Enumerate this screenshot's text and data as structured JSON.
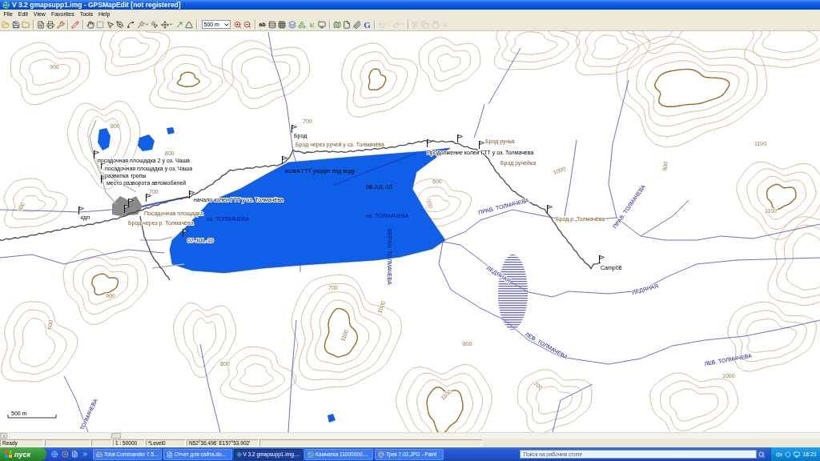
{
  "window": {
    "title": "V 3.2 gmapsupp1.img - GPSMapEdit [not registered]"
  },
  "menu": [
    "File",
    "Edit",
    "View",
    "Favorites",
    "Tools",
    "Help"
  ],
  "toolbar": [
    {
      "kind": "tool",
      "disabled": false
    },
    {
      "kind": "tool",
      "disabled": false
    },
    {
      "kind": "tool",
      "disabled": false
    },
    {
      "kind": "separator"
    },
    {
      "kind": "tool",
      "disabled": false
    },
    {
      "kind": "tool",
      "disabled": false
    },
    {
      "kind": "tool",
      "disabled": false
    },
    {
      "kind": "separator"
    },
    {
      "kind": "tool",
      "disabled": false
    },
    {
      "kind": "separator"
    },
    {
      "kind": "tool",
      "disabled": false
    },
    {
      "kind": "tool",
      "disabled": false
    },
    {
      "kind": "tool",
      "disabled": false
    },
    {
      "kind": "tool",
      "disabled": false
    },
    {
      "kind": "tool",
      "disabled": false
    },
    {
      "kind": "split",
      "disabled": false
    },
    {
      "kind": "tool",
      "disabled": false
    },
    {
      "kind": "split",
      "disabled": false
    },
    {
      "kind": "tool",
      "disabled": false
    },
    {
      "kind": "tool",
      "disabled": false
    },
    {
      "kind": "separator"
    },
    {
      "kind": "scale",
      "value": "500 m"
    },
    {
      "kind": "tool",
      "disabled": false
    },
    {
      "kind": "tool",
      "disabled": false
    },
    {
      "kind": "separator"
    },
    {
      "kind": "text",
      "label": "ab",
      "disabled": false
    },
    {
      "kind": "tool",
      "disabled": false
    },
    {
      "kind": "tool",
      "disabled": false
    },
    {
      "kind": "tool",
      "disabled": false
    },
    {
      "kind": "tool",
      "disabled": false
    },
    {
      "kind": "tool",
      "disabled": false
    },
    {
      "kind": "tool",
      "disabled": false
    },
    {
      "kind": "separator"
    },
    {
      "kind": "tool",
      "disabled": false
    },
    {
      "kind": "tool",
      "disabled": false
    },
    {
      "kind": "tool",
      "disabled": false
    },
    {
      "kind": "text",
      "label": "G",
      "disabled": false
    },
    {
      "kind": "separator"
    },
    {
      "kind": "split",
      "disabled": true
    },
    {
      "kind": "split",
      "disabled": true
    },
    {
      "kind": "separator"
    },
    {
      "kind": "tool",
      "disabled": true
    },
    {
      "kind": "tool",
      "disabled": true
    },
    {
      "kind": "tool",
      "disabled": true
    },
    {
      "kind": "tool",
      "disabled": true
    }
  ],
  "map": {
    "labels": [
      {
        "text": "посадочная площадка 2 у оз. Чаша",
        "kind": "waypoint"
      },
      {
        "text": "посадочная площадка у оз. Чаша",
        "kind": "waypoint"
      },
      {
        "text": "развилка тропы",
        "kind": "waypoint"
      },
      {
        "text": "место разворота автомобилей",
        "kind": "waypoint"
      },
      {
        "text": "кдп",
        "kind": "waypoint"
      },
      {
        "text": "Посадочная площадка",
        "kind": "note"
      },
      {
        "text": "начало колеи ГТТ у оз. Толмачёва",
        "kind": "waypoint"
      },
      {
        "text": "Брод через р. Толмачёва",
        "kind": "note"
      },
      {
        "text": "оз. ТОЛМАЧЕВА",
        "kind": "water"
      },
      {
        "text": "07-JUL-10",
        "kind": "waypoint"
      },
      {
        "text": "Брод",
        "kind": "waypoint"
      },
      {
        "text": "Брод через ручей у оз. Толмачёва",
        "kind": "note"
      },
      {
        "text": "колея ГТТ уходит под воду",
        "kind": "waypoint"
      },
      {
        "text": "08-JUL-10",
        "kind": "waypoint"
      },
      {
        "text": "оз. ТОЛМАЧЕВА",
        "kind": "water"
      },
      {
        "text": "ВЕРХН. ТОЛМАЧЕВА",
        "kind": "water"
      },
      {
        "text": "Брод ручья",
        "kind": "note"
      },
      {
        "text": "Продолжение колеи ГТТ у оз. Толмачева",
        "kind": "waypoint"
      },
      {
        "text": "Брод ручейка",
        "kind": "note"
      },
      {
        "text": "ПРАВ. ТОЛМАЧЕВА",
        "kind": "water"
      },
      {
        "text": "Брод р. Толмачёва",
        "kind": "note"
      },
      {
        "text": "ПРАВ. ТОЛМАЧЕВА",
        "kind": "water"
      },
      {
        "text": "Camp08",
        "kind": "waypoint"
      },
      {
        "text": "ЛЕДЯНАЯ",
        "kind": "water"
      },
      {
        "text": "ЛЕДЯНАЯ",
        "kind": "water"
      },
      {
        "text": "ЛЕВ. ТОЛМАЧЕВА",
        "kind": "water"
      },
      {
        "text": "ЛЕВ. ТОЛМАЧЕВА",
        "kind": "water"
      },
      {
        "text": "ТОЛМАЧЕВА",
        "kind": "water"
      }
    ],
    "contour_labels": [
      "900",
      "800",
      "800",
      "700",
      "700",
      "600",
      "700",
      "1000",
      "800",
      "1100",
      "1100",
      "900",
      "900",
      "700",
      "1000",
      "1100",
      "800",
      "700",
      "1100",
      "600",
      "1000",
      "800"
    ],
    "scale_bar": "500 m"
  },
  "status_bar": {
    "message": "Ready",
    "scale": "1 : 50000",
    "level": "*Level0",
    "coordinates": "N52°36.496' E157°53.902'"
  },
  "taskbar": {
    "start": "пуск",
    "tasks": [
      {
        "label": "Total Commander 7.5...",
        "selected": false
      },
      {
        "label": "Отчет для сайта.do...",
        "selected": false
      },
      {
        "label": "V 3.2 gmapsupp1.img....",
        "selected": true
      },
      {
        "label": "Камчатка 11000000....",
        "selected": false
      },
      {
        "label": "Трек 7.02.JPG - Paint",
        "selected": false
      }
    ],
    "search": {
      "placeholder": "Поиск на рабочем столе"
    },
    "clock": "18:21"
  }
}
